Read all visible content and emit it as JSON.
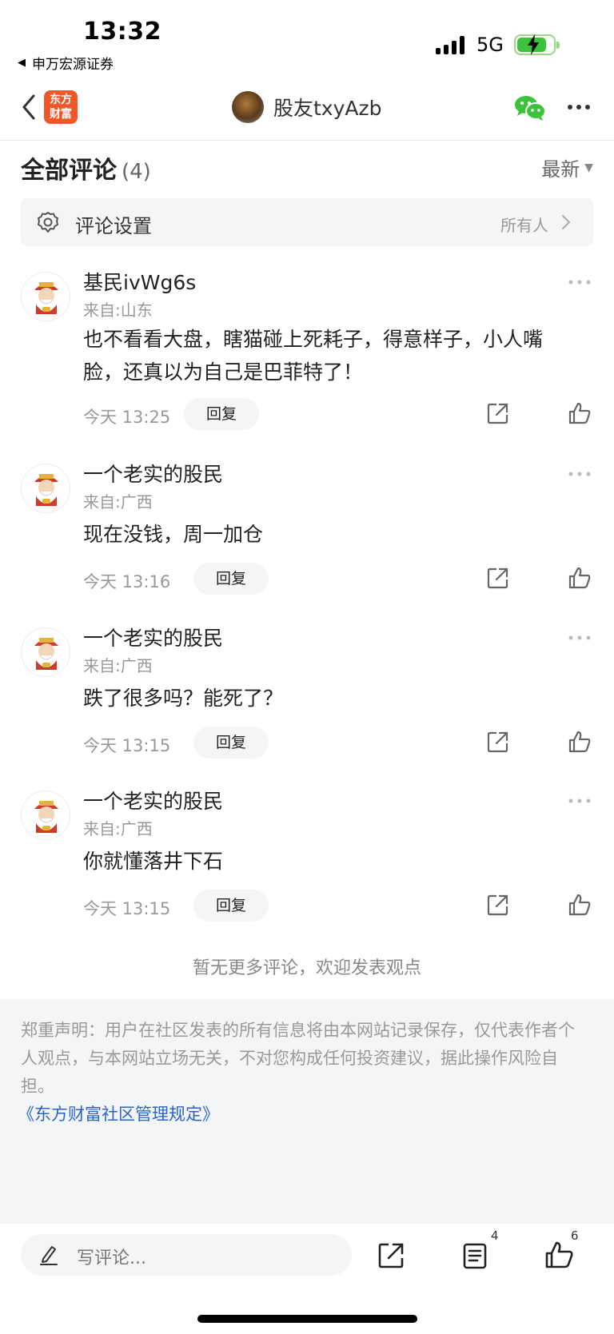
{
  "status_bar": {
    "time": "13:32",
    "back_app": "申万宏源证券",
    "network": "5G"
  },
  "nav": {
    "logo_line1": "东方",
    "logo_line2": "财富",
    "user_name": "股友txyAzb"
  },
  "comments_header": {
    "title": "全部评论",
    "count": "(4)",
    "sort_label": "最新"
  },
  "settings": {
    "label": "评论设置",
    "value": "所有人"
  },
  "comments": [
    {
      "name": "基民ivWg6s",
      "location": "来自:山东",
      "text": "也不看看大盘，瞎猫碰上死耗子，得意样子，小人嘴脸，还真以为自己是巴菲特了！",
      "time": "今天 13:25",
      "reply_label": "回复"
    },
    {
      "name": "一个老实的股民",
      "location": "来自:广西",
      "text": "现在没钱，周一加仓",
      "time": "今天 13:16",
      "reply_label": "回复"
    },
    {
      "name": "一个老实的股民",
      "location": "来自:广西",
      "text": "跌了很多吗？能死了？",
      "time": "今天 13:15",
      "reply_label": "回复"
    },
    {
      "name": "一个老实的股民",
      "location": "来自:广西",
      "text": "你就懂落井下石",
      "time": "今天 13:15",
      "reply_label": "回复"
    }
  ],
  "no_more_text": "暂无更多评论，欢迎发表观点",
  "disclaimer": {
    "text": "郑重声明：用户在社区发表的所有信息将由本网站记录保存，仅代表作者个人观点，与本网站立场无关，不对您构成任何投资建议，据此操作风险自担。",
    "link": "《东方财富社区管理规定》"
  },
  "bottom_bar": {
    "compose_placeholder": "写评论...",
    "list_count": "4",
    "like_count": "6"
  },
  "colors": {
    "accent_orange": "#f0562a",
    "link_blue": "#2a63c8",
    "wechat_green": "#3bc33b",
    "battery_green": "#3bc33b"
  },
  "icons": [
    "back-chevron-icon",
    "wechat-icon",
    "more-icon",
    "gear-icon",
    "chevron-right-icon",
    "share-icon",
    "like-icon",
    "pencil-icon",
    "list-icon"
  ]
}
